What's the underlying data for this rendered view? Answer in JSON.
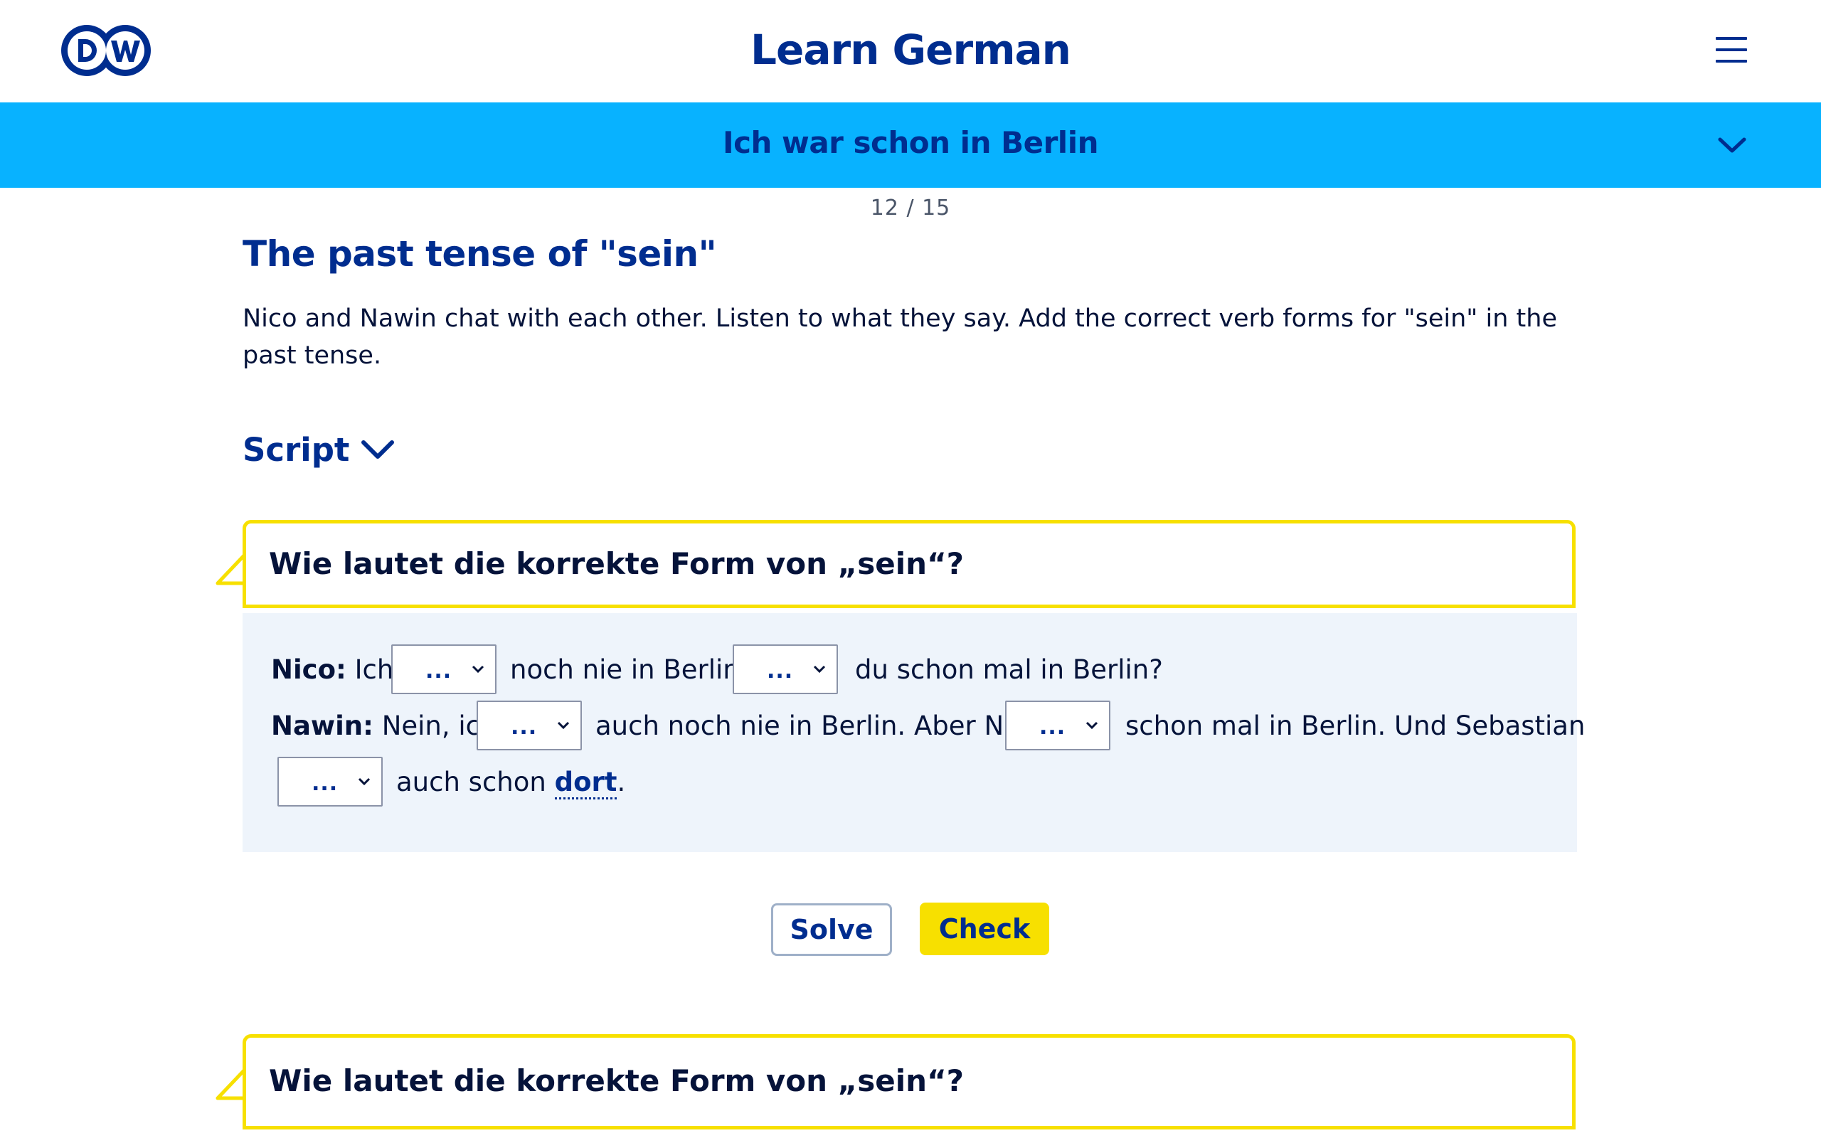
{
  "header": {
    "logo_text": "DW",
    "title": "Learn German"
  },
  "lesson": {
    "title": "Ich war schon in Berlin",
    "progress": "12 / 15"
  },
  "exercise": {
    "title": "The past tense of \"sein\"",
    "instructions": "Nico and Nawin chat with each other. Listen to what they say. Add the correct verb forms for \"sein\" in the past tense.",
    "script_label": "Script"
  },
  "questions": [
    {
      "prompt": "Wie lautet die korrekte Form von „sein“?",
      "line1": {
        "speaker": "Nico:",
        "t1": "Ich",
        "t2": "noch nie in Berlin.",
        "t3": "du schon mal in Berlin?"
      },
      "line2": {
        "speaker": "Nawin:",
        "t1": "Nein, ich",
        "t2": "auch noch nie in Berlin. Aber Nina",
        "t3": "schon mal in Berlin. Und Sebastian"
      },
      "line3": {
        "t1": "auch schon",
        "link": "dort",
        "end": "."
      },
      "select_placeholder": "..."
    },
    {
      "prompt": "Wie lautet die korrekte Form von „sein“?"
    }
  ],
  "buttons": {
    "solve": "Solve",
    "check": "Check"
  },
  "colors": {
    "brand_blue": "#002d8f",
    "lesson_bar": "#08b2ff",
    "accent_yellow": "#f7e000",
    "card_bg": "#eef4fb"
  },
  "icons": [
    "dw-logo",
    "hamburger-menu-icon",
    "chevron-down-icon",
    "select-caret-icon"
  ]
}
